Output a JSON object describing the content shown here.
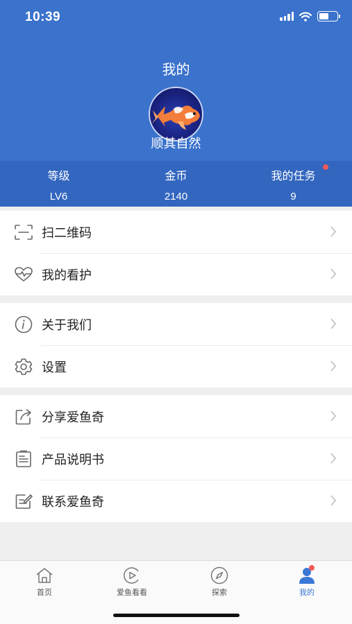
{
  "status_bar": {
    "time": "10:39"
  },
  "header": {
    "title": "我的",
    "username": "顺其自然"
  },
  "stats": [
    {
      "label": "等级",
      "value": "LV6"
    },
    {
      "label": "金币",
      "value": "2140"
    },
    {
      "label": "我的任务",
      "value": "9"
    }
  ],
  "menu": {
    "group1": [
      {
        "label": "扫二维码",
        "icon": "qr-scan-icon"
      },
      {
        "label": "我的看护",
        "icon": "heart-pulse-icon"
      }
    ],
    "group2": [
      {
        "label": "关于我们",
        "icon": "info-icon"
      },
      {
        "label": "设置",
        "icon": "gear-icon"
      }
    ],
    "group3": [
      {
        "label": "分享爱鱼奇",
        "icon": "share-icon"
      },
      {
        "label": "产品说明书",
        "icon": "manual-icon"
      },
      {
        "label": "联系爱鱼奇",
        "icon": "contact-icon"
      }
    ]
  },
  "tabbar": [
    {
      "label": "首页",
      "icon": "home-icon"
    },
    {
      "label": "爱鱼看看",
      "icon": "video-icon"
    },
    {
      "label": "探索",
      "icon": "compass-icon"
    },
    {
      "label": "我的",
      "icon": "person-icon",
      "active": true
    }
  ],
  "colors": {
    "header": "#3a72cc",
    "stats_bar": "#3266bf",
    "accent": "#3a78d4",
    "badge": "#f05a5a"
  }
}
